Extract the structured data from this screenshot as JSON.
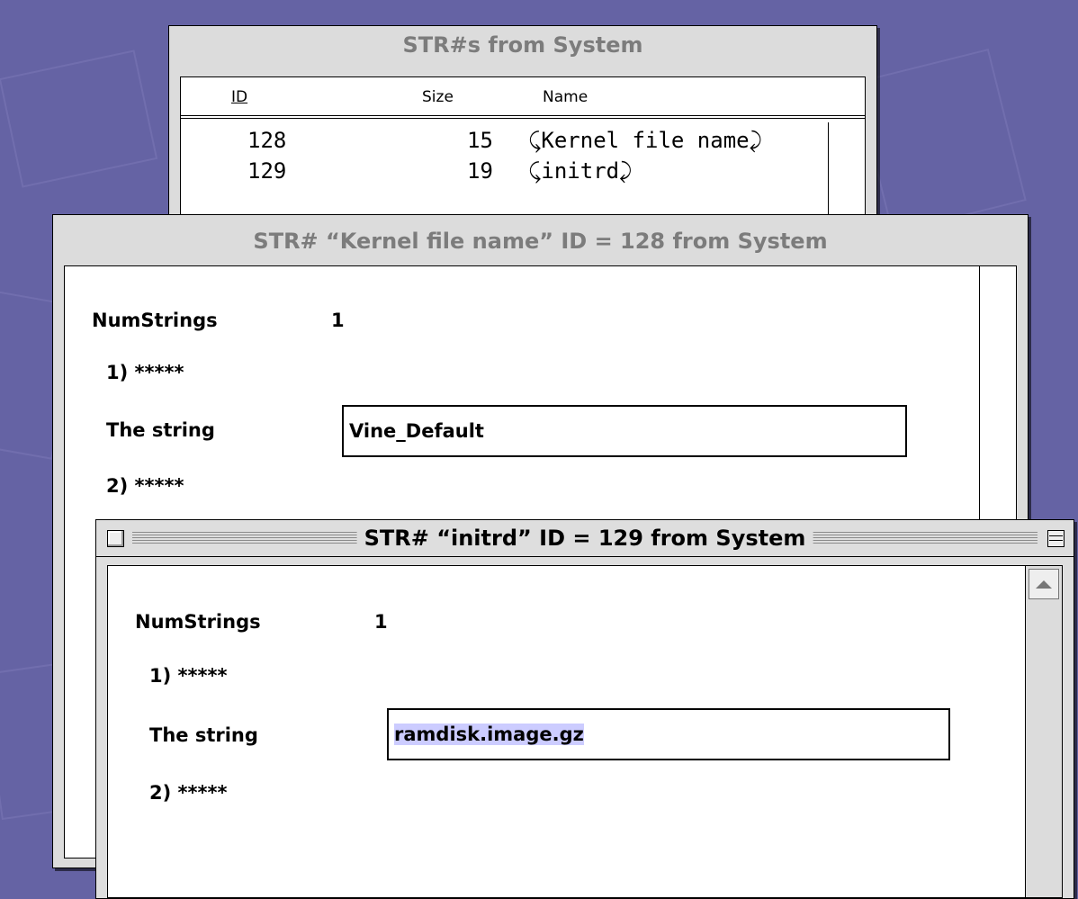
{
  "list_window": {
    "title": "STR#s from System",
    "columns": {
      "id": "ID",
      "size": "Size",
      "name": "Name"
    },
    "rows": [
      {
        "id": "128",
        "size": "15",
        "name": "⤹Kernel file name⤸"
      },
      {
        "id": "129",
        "size": "19",
        "name": "⤹initrd⤸"
      }
    ]
  },
  "kernel_window": {
    "title": "STR# “Kernel file name” ID = 128 from System",
    "num_strings_label": "NumStrings",
    "num_strings_value": "1",
    "item1_label": "1) *****",
    "string_label": "The string",
    "string_value": "Vine_Default",
    "item2_label": "2) *****"
  },
  "initrd_window": {
    "title": "STR# “initrd” ID = 129 from System",
    "num_strings_label": "NumStrings",
    "num_strings_value": "1",
    "item1_label": "1) *****",
    "string_label": "The string",
    "string_value": "ramdisk.image.gz",
    "item2_label": "2) *****"
  },
  "colors": {
    "desktop": "#6563a4",
    "selection": "#ccccff",
    "window": "#dcdcdc"
  },
  "icons": [
    "close-box-icon",
    "zoom-box-icon",
    "scroll-up-arrow-icon"
  ]
}
